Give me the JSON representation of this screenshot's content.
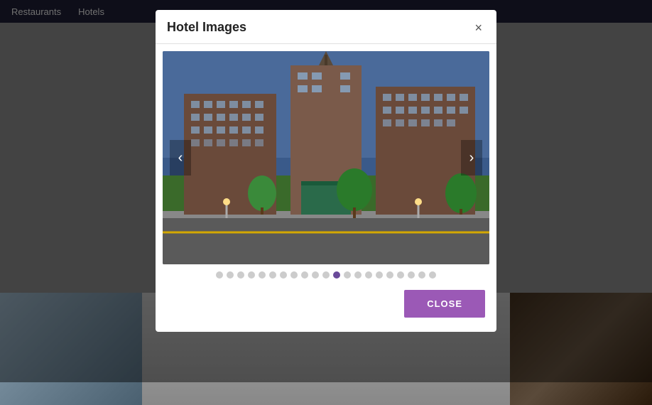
{
  "nav": {
    "items": [
      {
        "label": "Restaurants"
      },
      {
        "label": "Hotels"
      }
    ]
  },
  "modal": {
    "title": "Hotel Images",
    "close_x_label": "×",
    "carousel": {
      "prev_label": "‹",
      "next_label": "›",
      "total_dots": 21,
      "active_dot_index": 11
    },
    "footer": {
      "close_label": "CLOSE"
    }
  }
}
